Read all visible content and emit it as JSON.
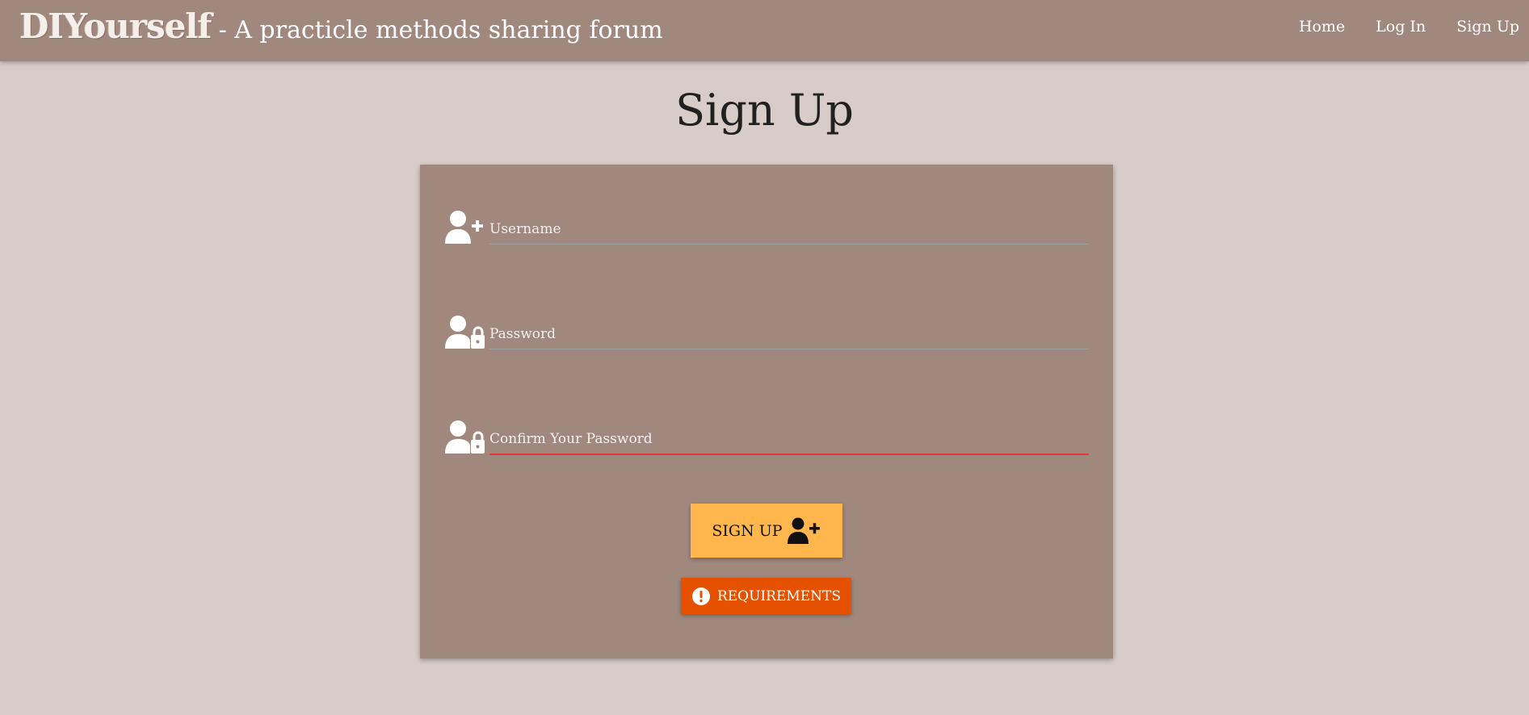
{
  "navbar": {
    "logo": "DIYourself",
    "tagline": "- A practicle methods sharing forum",
    "links": [
      "Home",
      "Log In",
      "Sign Up"
    ]
  },
  "page": {
    "title": "Sign Up"
  },
  "form": {
    "username": {
      "placeholder": "Username",
      "value": "",
      "icon": "user-plus-icon"
    },
    "password": {
      "placeholder": "Password",
      "value": "",
      "icon": "user-lock-icon"
    },
    "confirm_password": {
      "placeholder": "Confirm Your Password",
      "value": "",
      "icon": "user-lock-icon"
    },
    "signup_button": "SIGN UP",
    "requirements_button": "REQUIREMENTS"
  },
  "colors": {
    "background": "#d7ccc8",
    "navbar": "#a1887f",
    "card": "#a1887f",
    "signup_button": "#ffb74d",
    "requirements_button": "#e65100",
    "invalid_underline": "#e53935"
  }
}
